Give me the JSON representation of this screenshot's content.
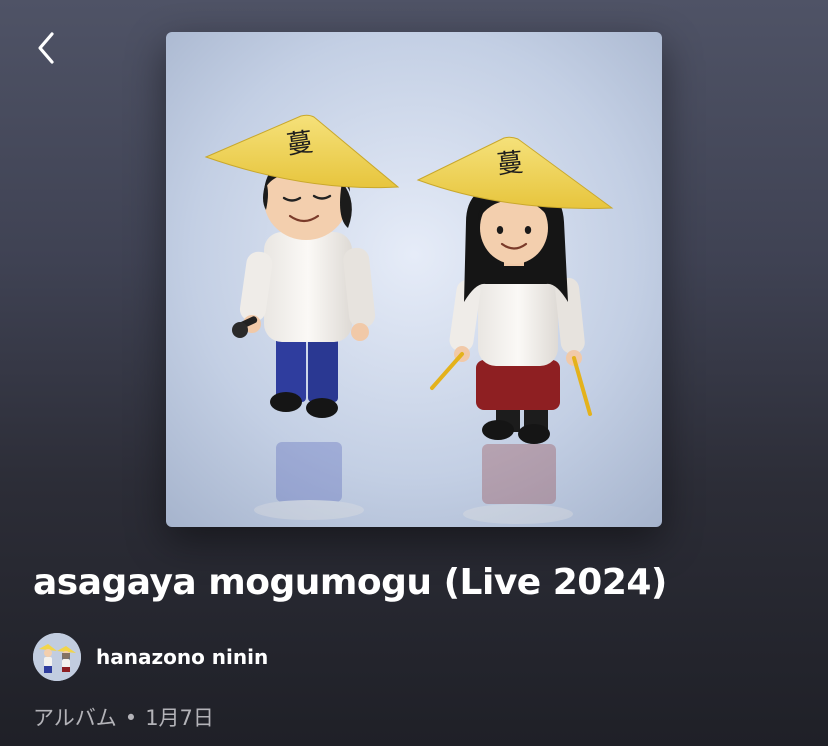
{
  "header": {
    "back_icon": "chevron-left-icon"
  },
  "album": {
    "title": "asagaya mogumogu (Live 2024)",
    "artist": "hanazono ninin",
    "type": "アルバム",
    "separator": "•",
    "release_date": "1月7日",
    "cover_description_icons": [
      "figure-man-with-hat",
      "figure-woman-with-hat"
    ]
  },
  "colors": {
    "background_top": "#4f5366",
    "background_bottom": "#1f2027",
    "meta_text": "#b3b3b8",
    "hat_yellow": "#f2d54a"
  }
}
